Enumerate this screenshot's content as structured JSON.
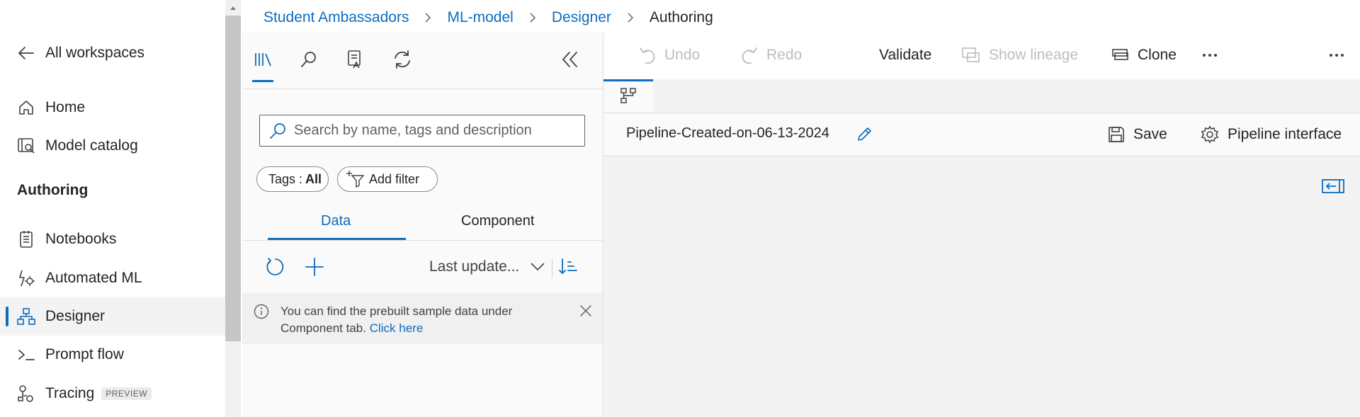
{
  "left_nav": {
    "all_workspaces": "All workspaces",
    "items": [
      {
        "label": "Home"
      },
      {
        "label": "Model catalog"
      },
      {
        "label": "Notebooks"
      },
      {
        "label": "Automated ML"
      },
      {
        "label": "Designer"
      },
      {
        "label": "Prompt flow"
      },
      {
        "label": "Tracing",
        "badge": "PREVIEW"
      }
    ],
    "section_header": "Authoring",
    "selected": "Designer",
    "accent_color": "#0f6cbd"
  },
  "breadcrumb": [
    "Student Ambassadors",
    "ML-model",
    "Designer",
    "Authoring"
  ],
  "library": {
    "search_placeholder": "Search by name, tags and description",
    "tags_label": "Tags :",
    "tags_value": "All",
    "add_filter": "Add filter",
    "subtabs": [
      "Data",
      "Component"
    ],
    "active_subtab": "Data",
    "sort_label": "Last update...",
    "notice_text": "You can find the prebuilt sample data under Component tab.",
    "notice_link": "Click here"
  },
  "toolbar": {
    "undo": "Undo",
    "redo": "Redo",
    "validate": "Validate",
    "show_lineage": "Show lineage",
    "clone": "Clone"
  },
  "pipeline": {
    "name": "Pipeline-Created-on-06-13-2024",
    "save": "Save",
    "pipeline_interface": "Pipeline interface"
  }
}
